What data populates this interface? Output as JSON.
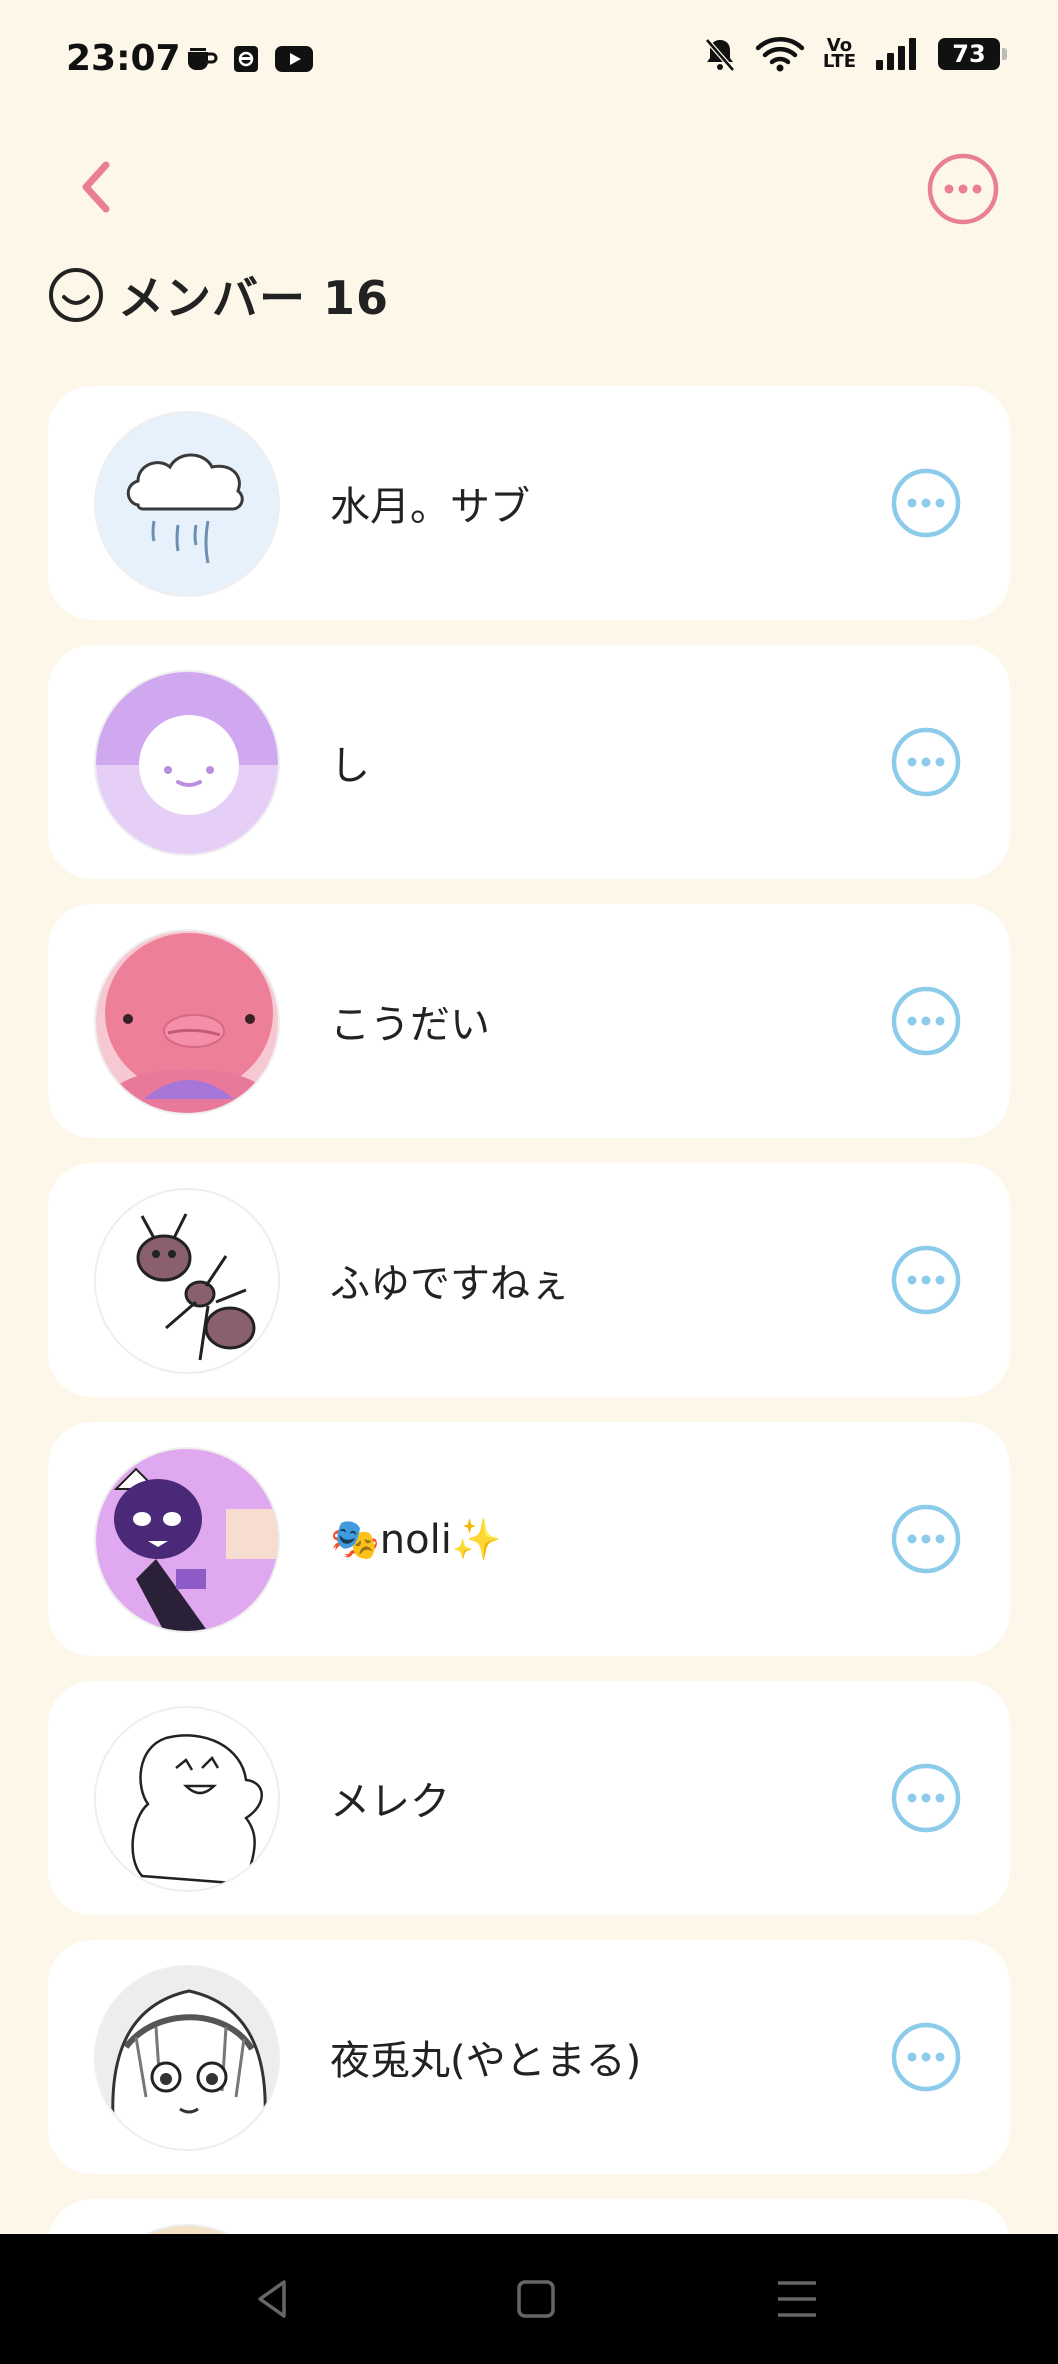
{
  "status_bar": {
    "time": "23:07",
    "battery": "73",
    "volte_top": "Vo",
    "volte_bottom": "LTE",
    "left_icons": [
      "coffee-cup-icon",
      "app-notification-icon",
      "youtube-icon"
    ],
    "right_icons": [
      "bell-muted-icon",
      "wifi-icon",
      "volte-icon",
      "signal-icon",
      "battery-icon"
    ]
  },
  "header": {
    "back_icon": "chevron-left-icon",
    "more_icon": "more-circle-icon",
    "title": "メンバー 16",
    "title_icon": "smiley-face-icon"
  },
  "members": [
    {
      "name": "水月。サブ",
      "avatar": "rain-cloud-avatar"
    },
    {
      "name": "し",
      "avatar": "purple-smiley-avatar"
    },
    {
      "name": "こうだい",
      "avatar": "pink-plush-avatar"
    },
    {
      "name": "ふゆですねぇ",
      "avatar": "ant-drawing-avatar"
    },
    {
      "name": "🎭noli✨",
      "avatar": "purple-character-avatar"
    },
    {
      "name": "メレク",
      "avatar": "sketch-ghost-avatar"
    },
    {
      "name": "夜兎丸(やとまる)",
      "avatar": "manga-girl-avatar"
    }
  ],
  "colors": {
    "background": "#FDF7EA",
    "accent_pink": "#E8808F",
    "accent_blue": "#8CCBEA",
    "card": "#FFFFFF"
  },
  "nav": [
    "back-triangle-icon",
    "home-square-icon",
    "menu-lines-icon"
  ]
}
